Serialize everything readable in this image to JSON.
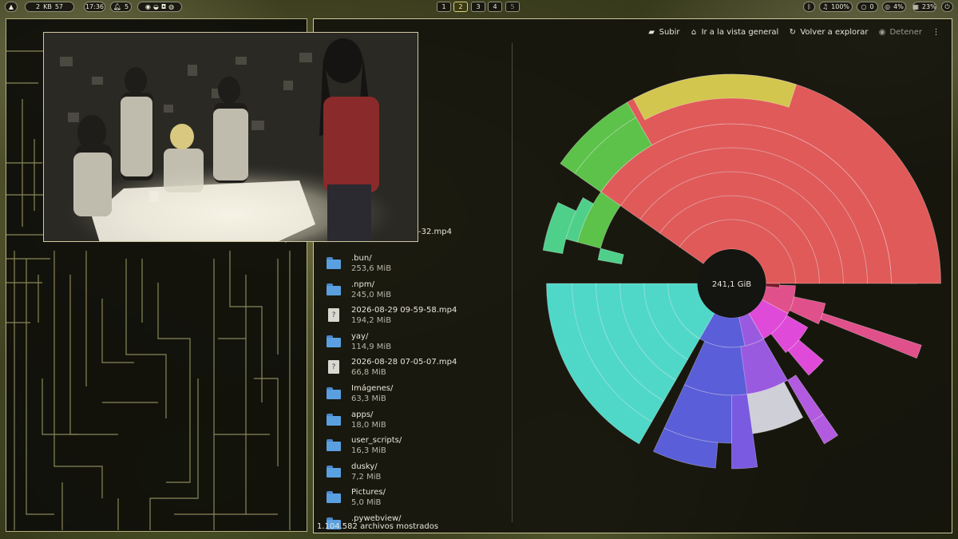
{
  "topbar": {
    "net": {
      "down_value": "2",
      "unit": "KB",
      "up_value": "57"
    },
    "clock": "17:36",
    "notifications": "5",
    "tray_icons": [
      "chrome-icon",
      "steam-like-icon",
      "discord-icon",
      "steam-icon"
    ],
    "workspaces": [
      "1",
      "2",
      "3",
      "4",
      "5"
    ],
    "active_workspace": "2",
    "volume": "100%",
    "bluetooth": "0",
    "cpu": "4%",
    "memory": "23%"
  },
  "analyzer": {
    "toolbar": {
      "up": "Subir",
      "overview": "Ir a la vista general",
      "rescan": "Volver a explorar",
      "stop": "Detener"
    },
    "partial_file": "-32.mp4",
    "files": [
      {
        "name": ".bun/",
        "size": "253,6 MiB",
        "kind": "folder"
      },
      {
        "name": ".npm/",
        "size": "245,0 MiB",
        "kind": "folder"
      },
      {
        "name": "2026-08-29 09-59-58.mp4",
        "size": "194,2 MiB",
        "kind": "unknown"
      },
      {
        "name": "yay/",
        "size": "114,9 MiB",
        "kind": "folder"
      },
      {
        "name": "2026-08-28 07-05-07.mp4",
        "size": "66,8 MiB",
        "kind": "unknown"
      },
      {
        "name": "Imágenes/",
        "size": "63,3 MiB",
        "kind": "folder"
      },
      {
        "name": "apps/",
        "size": "18,0 MiB",
        "kind": "folder"
      },
      {
        "name": "user_scripts/",
        "size": "16,3 MiB",
        "kind": "folder"
      },
      {
        "name": "dusky/",
        "size": "7,2 MiB",
        "kind": "folder"
      },
      {
        "name": "Pictures/",
        "size": "5,0 MiB",
        "kind": "folder"
      },
      {
        "name": ".pywebview/",
        "size": "",
        "kind": "folder"
      }
    ],
    "status": "1.104.582 archivos mostrados",
    "center_total": "241,1 GiB",
    "colors": {
      "red": "#e05a5a",
      "yellow": "#d2c64e",
      "green": "#5cc24a",
      "teal": "#4fd8c8",
      "blue": "#5a5ed8",
      "purple": "#9a5ae0",
      "magenta": "#e04ad8",
      "pink": "#e0508a",
      "gray": "#cfcfd8"
    }
  }
}
